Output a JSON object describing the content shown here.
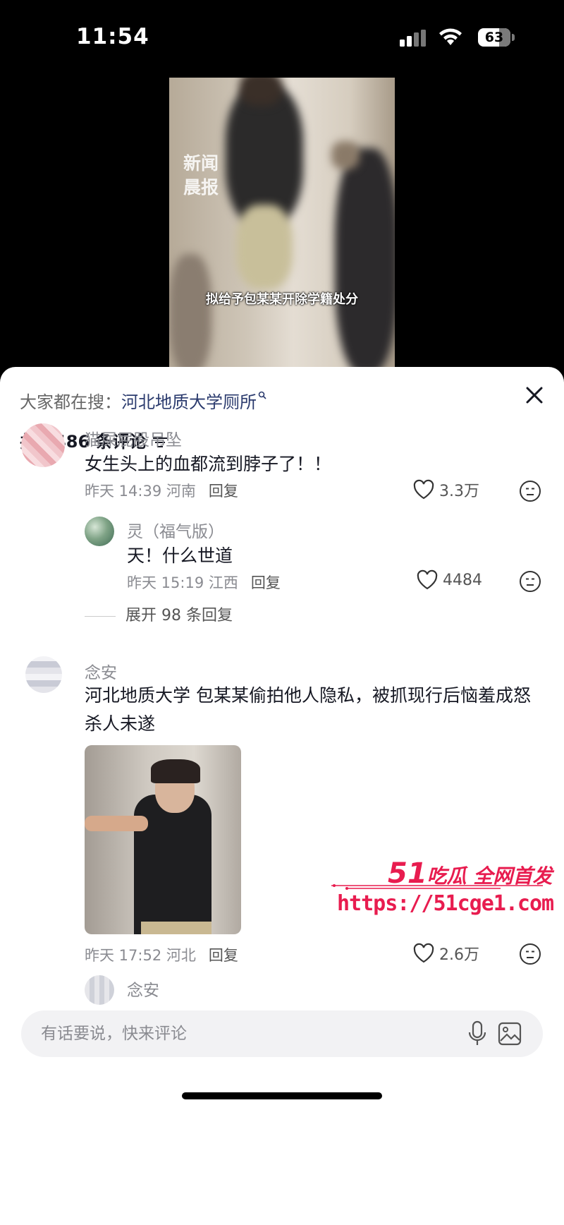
{
  "status_bar": {
    "time": "11:54",
    "battery": "63",
    "icons": [
      "signal-icon",
      "wifi-icon",
      "battery-icon"
    ]
  },
  "video": {
    "watermark": "新闻晨报",
    "subtitle": "拟给予包某某开除学籍处分"
  },
  "sheet": {
    "search_prefix": "大家都在搜：",
    "search_term": "河北地质大学厕所",
    "comment_count": "共 2486 条评论"
  },
  "comments": [
    {
      "user": "猫屎屁股吊坠",
      "text": "女生头上的血都流到脖子了！！",
      "time_loc": "昨天 14:39 河南",
      "reply_label": "回复",
      "likes": "3.3万"
    },
    {
      "user": "灵（福气版）",
      "text": "天！什么世道",
      "time_loc": "昨天 15:19 江西",
      "reply_label": "回复",
      "likes": "4484"
    },
    {
      "user": "念安",
      "text": "河北地质大学 包某某偷拍他人隐私，被抓现行后恼羞成怒杀人未遂",
      "time_loc": "昨天 17:52 河北",
      "reply_label": "回复",
      "likes": "2.6万"
    },
    {
      "user": "念安"
    }
  ],
  "expand_replies": "展开 98 条回复",
  "promo": {
    "brand_num": "51",
    "brand_text": "吃瓜 全网首发",
    "url": "https://51cge1.com"
  },
  "input": {
    "placeholder": "有话要说，快来评论"
  },
  "colors": {
    "link": "#2b3b6e",
    "promo": "#e81c4f",
    "muted": "#8a8b91"
  }
}
